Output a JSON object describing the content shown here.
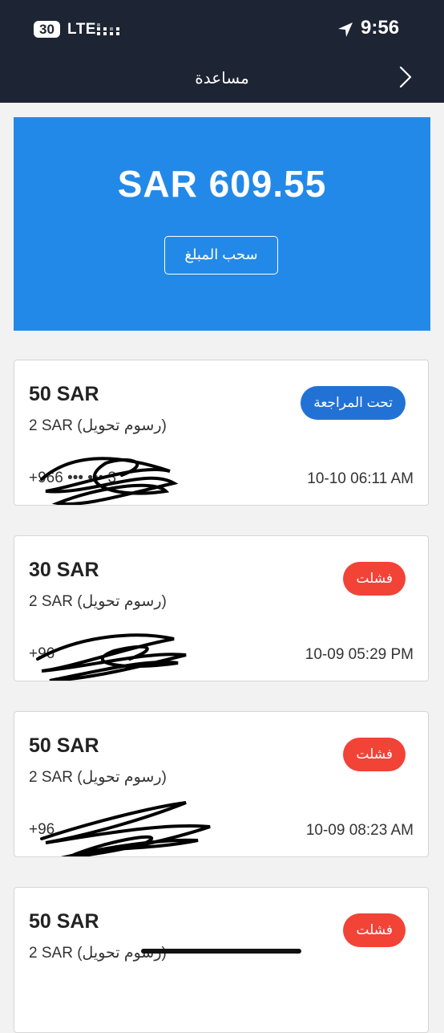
{
  "status_bar": {
    "cell_badge": "30",
    "network": "LTE",
    "time": "9:56"
  },
  "nav": {
    "title": "مساعدة",
    "back_icon": "chevron-right-icon"
  },
  "balance": {
    "amount": "SAR 609.55",
    "withdraw_label": "سحب المبلغ"
  },
  "transactions": [
    {
      "amount": "50 SAR",
      "fee": "2 SAR (رسوم تحويل)",
      "phone": "+966 ••• ••• 3",
      "date": "10-10 06:11 AM",
      "status": "تحت المراجعة",
      "status_color": "#2272d6"
    },
    {
      "amount": "30 SAR",
      "fee": "2 SAR (رسوم تحويل)",
      "phone": "+96",
      "date": "10-09 05:29 PM",
      "status": "فشلت",
      "status_color": "#f14336"
    },
    {
      "amount": "50 SAR",
      "fee": "2 SAR (رسوم تحويل)",
      "phone": "+96",
      "date": "10-09 08:23 AM",
      "status": "فشلت",
      "status_color": "#f14336"
    },
    {
      "amount": "50 SAR",
      "fee": "2 SAR (رسوم تحويل)",
      "phone": "",
      "date": "",
      "status": "فشلت",
      "status_color": "#f14336"
    }
  ],
  "colors": {
    "header_bg": "#1d2433",
    "balance_bg": "#2389e8"
  }
}
